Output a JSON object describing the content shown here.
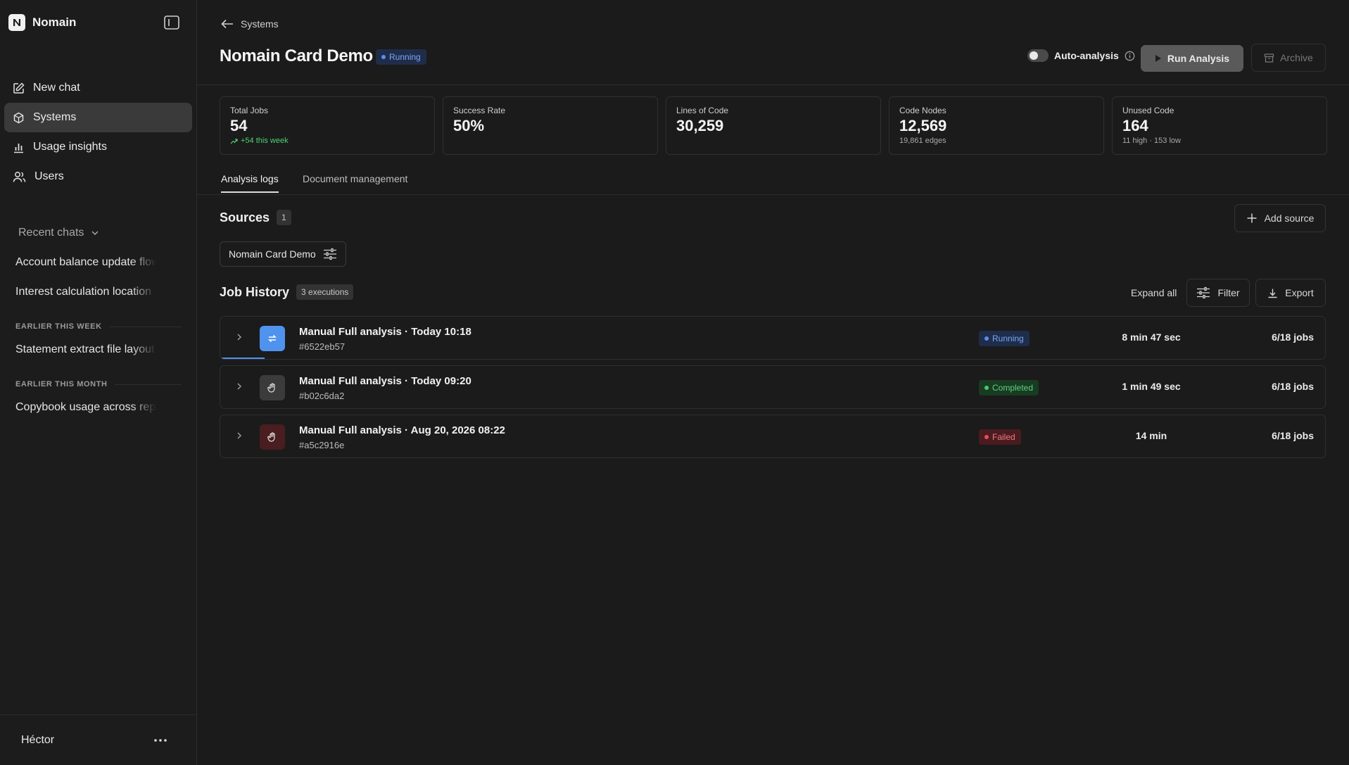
{
  "brand": {
    "name": "Nomain"
  },
  "nav": [
    {
      "label": "New chat",
      "icon": "edit-icon"
    },
    {
      "label": "Systems",
      "icon": "hexagon-icon",
      "active": true
    },
    {
      "label": "Usage insights",
      "icon": "bar-chart-icon"
    },
    {
      "label": "Users",
      "icon": "users-icon"
    }
  ],
  "recent": {
    "header": "Recent chats",
    "items": [
      "Account balance update flow",
      "Interest calculation location"
    ],
    "sections": [
      {
        "label": "EARLIER THIS WEEK",
        "items": [
          "Statement extract file layout"
        ]
      },
      {
        "label": "EARLIER THIS MONTH",
        "items": [
          "Copybook usage across repos"
        ]
      }
    ]
  },
  "user": {
    "name": "Héctor"
  },
  "breadcrumb": {
    "back_label": "Systems"
  },
  "page": {
    "title": "Nomain Card Demo",
    "status": "Running",
    "auto_analysis_label": "Auto-analysis",
    "auto_analysis_enabled": false,
    "run_label": "Run Analysis",
    "archive_label": "Archive"
  },
  "stats": [
    {
      "label": "Total Jobs",
      "value": "54",
      "sub": "+54 this week",
      "sub_trend": "up"
    },
    {
      "label": "Success Rate",
      "value": "50%",
      "sub": ""
    },
    {
      "label": "Lines of Code",
      "value": "30,259",
      "sub": ""
    },
    {
      "label": "Code Nodes",
      "value": "12,569",
      "sub": "19,861 edges"
    },
    {
      "label": "Unused Code",
      "value": "164",
      "sub": "11 high · 153 low"
    }
  ],
  "tabs": [
    {
      "label": "Analysis logs",
      "active": true
    },
    {
      "label": "Document management",
      "active": false
    }
  ],
  "sources": {
    "title": "Sources",
    "count": "1",
    "add_label": "Add source",
    "items": [
      "Nomain Card Demo"
    ]
  },
  "jobs": {
    "title": "Job History",
    "count_label": "3 executions",
    "expand_label": "Expand all",
    "filter_label": "Filter",
    "export_label": "Export",
    "rows": [
      {
        "title": "Manual Full analysis · Today 10:18",
        "hash": "#6522eb57",
        "status": "Running",
        "duration": "8 min 47 sec",
        "jobs": "6/18 jobs",
        "icon": "refresh-icon",
        "progress": 0.04
      },
      {
        "title": "Manual Full analysis · Today 09:20",
        "hash": "#b02c6da2",
        "status": "Completed",
        "duration": "1 min 49 sec",
        "jobs": "6/18 jobs",
        "icon": "hand-icon"
      },
      {
        "title": "Manual Full analysis · Aug 20, 2026 08:22",
        "hash": "#a5c2916e",
        "status": "Failed",
        "duration": "14 min",
        "jobs": "6/18 jobs",
        "icon": "hand-icon"
      }
    ]
  },
  "colors": {
    "accent": "#4f93ee",
    "success": "#3fcf6a",
    "danger": "#ec4c55",
    "background": "#1b1b1b"
  }
}
